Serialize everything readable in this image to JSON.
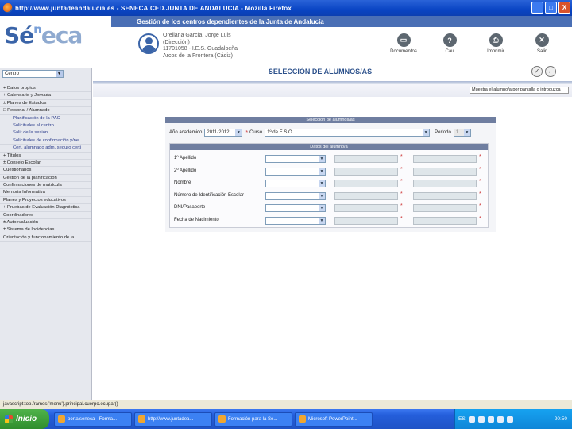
{
  "window": {
    "title": "http://www.juntadeandalucia.es - SENECA.CED.JUNTA DE ANDALUCIA - Mozilla Firefox",
    "buttons": [
      "_",
      "□",
      "X"
    ]
  },
  "header": {
    "banner": "Gestión de los centros dependientes de la Junta de Andalucía",
    "logo": {
      "se": "Sé",
      "sup": "n",
      "rest": "eca"
    },
    "user_lines": [
      "Orellana García, Jorge Luis",
      "(Dirección)",
      "11701058 - I.E.S. Guadalpeña",
      "Arcos de la Frontera (Cádiz)"
    ],
    "tools": [
      {
        "label": "Documentos",
        "icon": "document-icon",
        "glyph": "▭"
      },
      {
        "label": "Cau",
        "icon": "help-icon",
        "glyph": "?"
      },
      {
        "label": "Imprimir",
        "icon": "printer-icon",
        "glyph": "⎙"
      },
      {
        "label": "Salir",
        "icon": "exit-icon",
        "glyph": "✕"
      }
    ]
  },
  "sidebar": {
    "centro_select": "Centro",
    "items": [
      {
        "label": "+ Datos propios",
        "level": 0
      },
      {
        "label": "+ Calendario y Jornada",
        "level": 0
      },
      {
        "label": "± Planes de Estudios",
        "level": 0
      },
      {
        "label": "□ Personal / Alumnado",
        "level": 0
      },
      {
        "label": "Planificación de la PAC",
        "level": 1
      },
      {
        "label": "Solicitudes al centro",
        "level": 1
      },
      {
        "label": "Salir de la sesión",
        "level": 1
      },
      {
        "label": "Solicitudes de confirmación y/ne",
        "level": 1
      },
      {
        "label": "Cert. alumnado adm. seguro certi",
        "level": 1
      },
      {
        "label": "+ Títulos",
        "level": 0
      },
      {
        "label": "± Consejo Escolar",
        "level": 0
      },
      {
        "label": "Cuestionarios",
        "level": 0
      },
      {
        "label": "Gestión de la planificación",
        "level": 0
      },
      {
        "label": "Confirmaciones de matrícula",
        "level": 0
      },
      {
        "label": "Memoria Informativa",
        "level": 0
      },
      {
        "label": "Planes y Proyectos educativos",
        "level": 0
      },
      {
        "label": "+ Pruebas de Evaluación Diagnóstica",
        "level": 0
      },
      {
        "label": "Coordinadores",
        "level": 0
      },
      {
        "label": "± Autoevaluación",
        "level": 0
      },
      {
        "label": "± Sistema de Incidencias",
        "level": 0
      },
      {
        "label": "Orientación y funcionamiento de la",
        "level": 0
      }
    ]
  },
  "main": {
    "title": "SELECCIÓN DE ALUMNOS/AS",
    "hint": "Muestra el alumno/a por pantalla o introduzca",
    "panel_title": "Selección de alumnos/as",
    "curso_label": "Año académico",
    "curso_value": "2011-2012",
    "nivel_label": "Curso",
    "nivel_value": "1º de E.S.O.",
    "periodo_label": "Periodo",
    "periodo_value": "1",
    "sub_title": "Datos del alumno/a",
    "fields": [
      {
        "label": "1º Apellido"
      },
      {
        "label": "2º Apellido"
      },
      {
        "label": "Nombre"
      },
      {
        "label": "Número de Identificación Escolar"
      },
      {
        "label": "DNI/Pasaporte"
      },
      {
        "label": "Fecha de Nacimiento"
      }
    ]
  },
  "statusbar": "javascript:top.frames('menu').principal.cuerpo.ocupar()",
  "taskbar": {
    "start": "Inicio",
    "tasks": [
      "portalseneca - Forma...",
      "http://www.juntadea...",
      "Formación para la Se...",
      "Microsoft PowerPoint..."
    ],
    "lang": "ES",
    "clock": "20:50"
  }
}
